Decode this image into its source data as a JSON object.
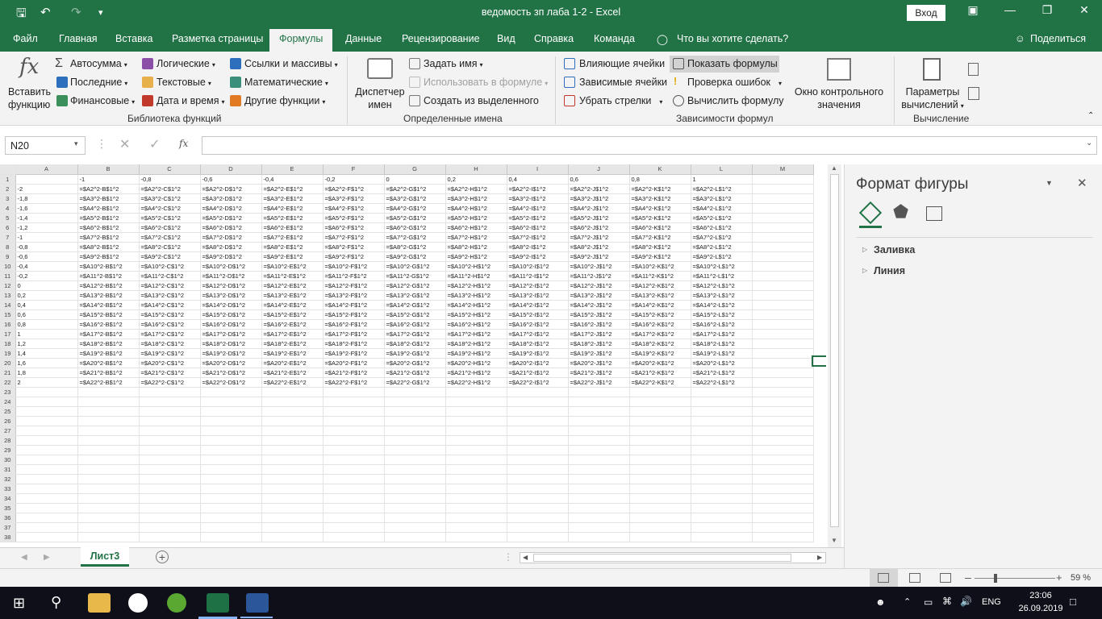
{
  "window": {
    "title": "ведомость зп лаба 1-2  -  Excel",
    "signin": "Вход"
  },
  "tabs": [
    "Файл",
    "Главная",
    "Вставка",
    "Разметка страницы",
    "Формулы",
    "Данные",
    "Рецензирование",
    "Вид",
    "Справка",
    "Команда"
  ],
  "tell_me": "Что вы хотите сделать?",
  "share": "Поделиться",
  "ribbon": {
    "insert_function": [
      "Вставить",
      "функцию"
    ],
    "autosum": "Автосумма",
    "recent": "Последние",
    "financial": "Финансовые",
    "logical": "Логические",
    "text": "Текстовые",
    "datetime": "Дата и время",
    "lookup": "Ссылки и массивы",
    "math": "Математические",
    "more": "Другие функции",
    "group_library": "Библиотека функций",
    "name_manager": [
      "Диспетчер",
      "имен"
    ],
    "define_name": "Задать имя",
    "use_in_formula": "Использовать в формуле",
    "create_from_sel": "Создать из выделенного",
    "group_names": "Определенные имена",
    "trace_prec": "Влияющие ячейки",
    "trace_dep": "Зависимые ячейки",
    "remove_arrows": "Убрать стрелки",
    "show_formulas": "Показать формулы",
    "error_check": "Проверка ошибок",
    "evaluate": "Вычислить формулу",
    "watch": [
      "Окно контрольного",
      "значения"
    ],
    "group_audit": "Зависимости формул",
    "calc_options": [
      "Параметры",
      "вычислений"
    ],
    "group_calc": "Вычисление"
  },
  "namebox": "N20",
  "fx_label": "fx",
  "columns": [
    "A",
    "B",
    "C",
    "D",
    "E",
    "F",
    "G",
    "H",
    "I",
    "J",
    "K",
    "L",
    "M"
  ],
  "row_count": 38,
  "header_row": [
    "",
    "-1",
    "-0,8",
    "-0,6",
    "-0,4",
    "-0,2",
    "0",
    "0,2",
    "0,4",
    "0,6",
    "0,8",
    "1",
    ""
  ],
  "col_letters": [
    "B",
    "C",
    "D",
    "E",
    "F",
    "G",
    "H",
    "I",
    "J",
    "K",
    "L"
  ],
  "a_values": [
    "-2",
    "-1,8",
    "-1,6",
    "-1,4",
    "-1,2",
    "-1",
    "-0,8",
    "-0,6",
    "-0,4",
    "-0,2",
    "0",
    "0,2",
    "0,4",
    "0,6",
    "0,8",
    "1",
    "1,2",
    "1,4",
    "1,6",
    "1,8",
    "2"
  ],
  "sheet_tab": "Лист3",
  "zoom": "59 %",
  "pane": {
    "title": "Формат фигуры",
    "fill": "Заливка",
    "line": "Линия"
  },
  "taskbar": {
    "lang": "ENG",
    "time": "23:06",
    "date": "26.09.2019"
  },
  "colors": {
    "accent": "#217346"
  }
}
